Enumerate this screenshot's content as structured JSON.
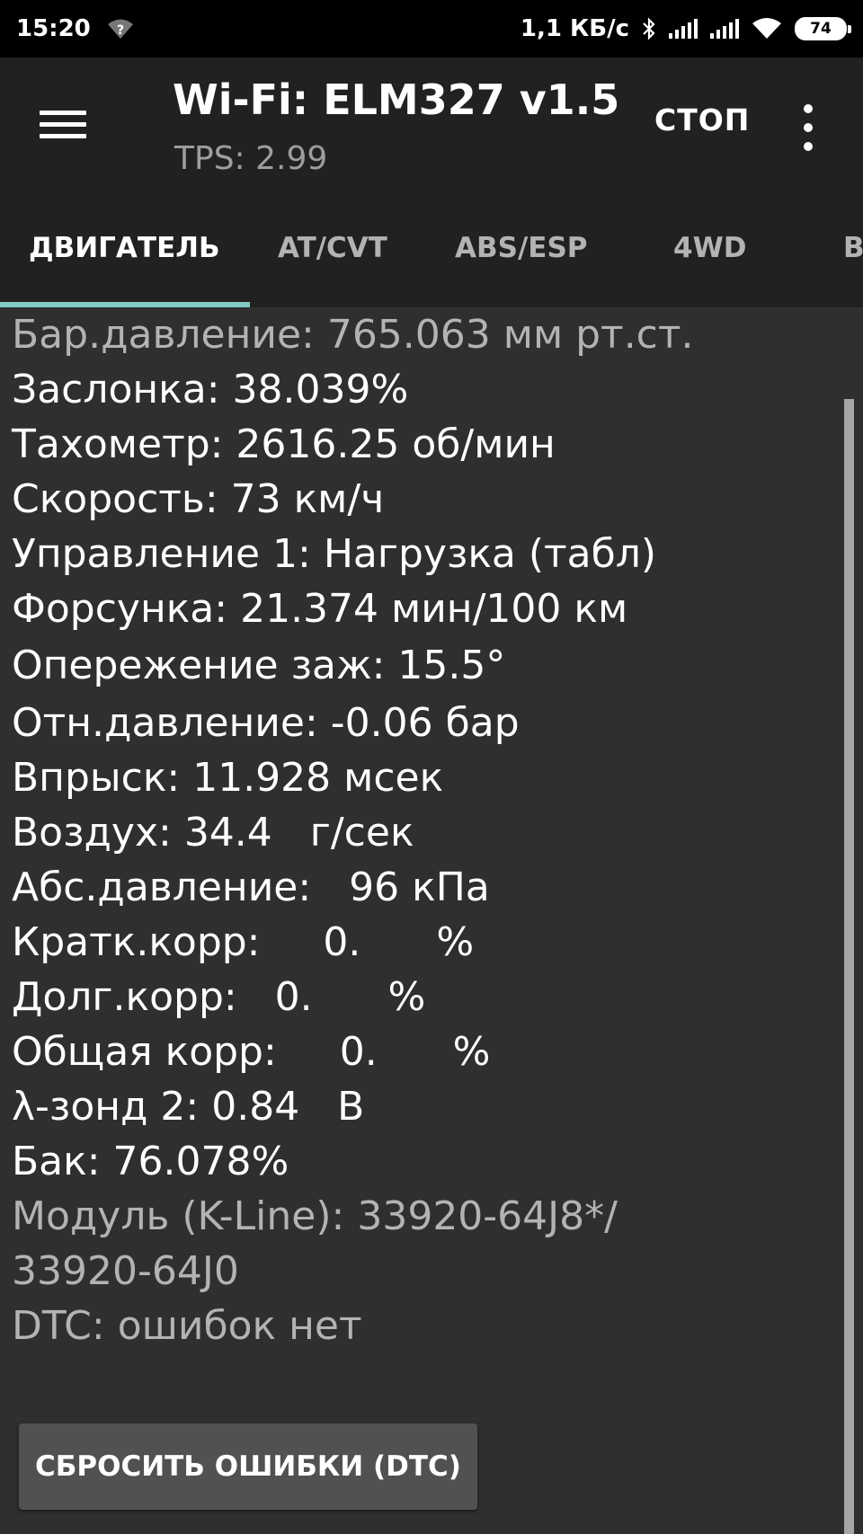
{
  "status_bar": {
    "time": "15:20",
    "network_speed": "1,1 КБ/с",
    "battery": "74"
  },
  "app_bar": {
    "title": "Wi-Fi: ELM327 v1.5",
    "subtitle": "TPS: 2.99",
    "stop_label": "СТОП"
  },
  "tabs": [
    {
      "label": "ДВИГАТЕЛЬ",
      "active": true
    },
    {
      "label": "AT/CVT",
      "active": false
    },
    {
      "label": "ABS/ESP",
      "active": false
    },
    {
      "label": "4WD",
      "active": false
    },
    {
      "label": "B",
      "active": false
    }
  ],
  "params": [
    "Бар.давление: 765.063 мм рт.ст.",
    "Заслонка: 38.039%",
    "Тахометр: 2616.25 об/мин",
    "Скорость: 73 км/ч",
    "Управление 1: Нагрузка (табл)",
    "Форсунка: 21.374 мин/100 км",
    "Опережение заж: 15.5°",
    "Отн.давление: -0.06 бар",
    "Впрыск: 11.928 мсек",
    "Воздух: 34.4   г/сек",
    "Абс.давление:   96 кПа",
    "Кратк.корр:     0.      %",
    "Долг.корр:   0.      %",
    "Общая корр:     0.      %",
    "λ-зонд 2: 0.84   В",
    "Бак: 76.078%",
    "Модуль (K-Line): 33920-64J8*/",
    "33920-64J0",
    "DTC: ошибок нет"
  ],
  "reset_button_label": "СБРОСИТЬ ОШИБКИ (DTC)"
}
